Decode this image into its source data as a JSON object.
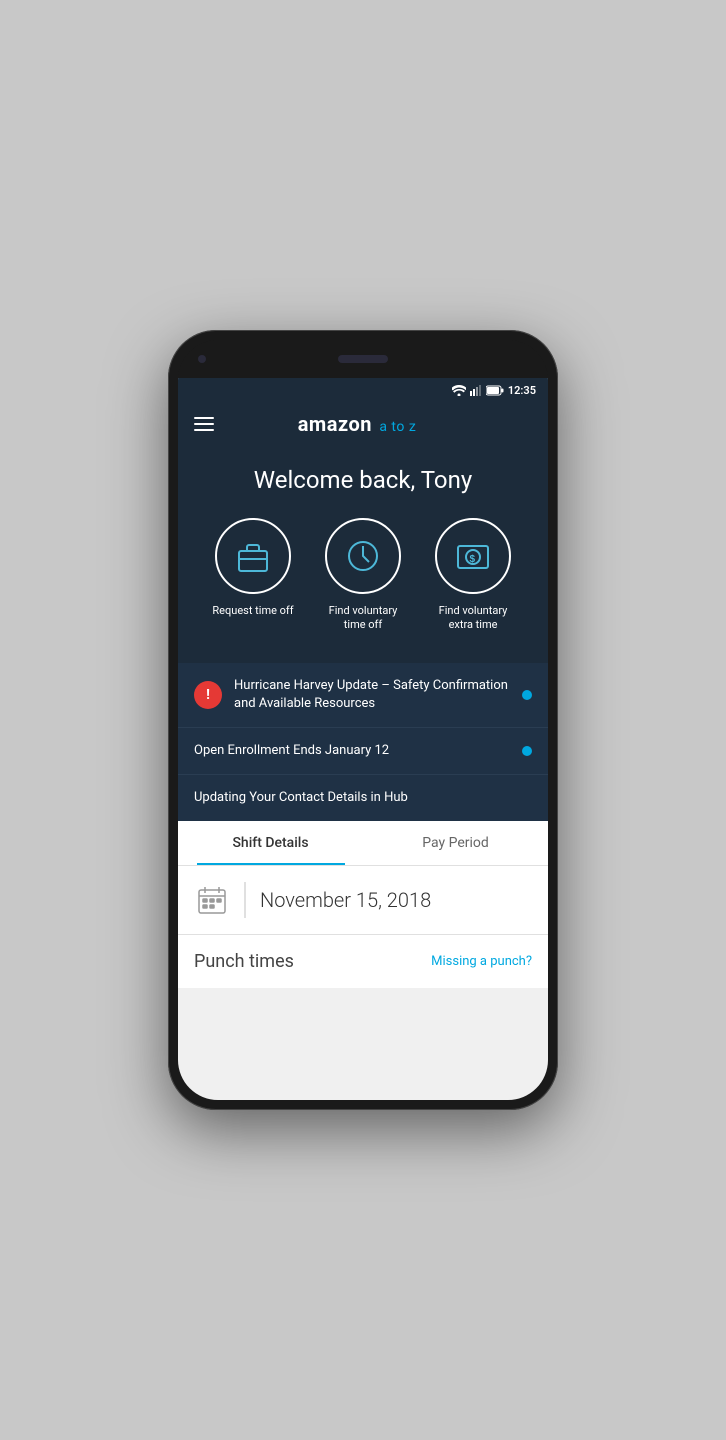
{
  "status_bar": {
    "time": "12:35"
  },
  "header": {
    "logo_amazon": "amazon",
    "logo_atoz": "a to z"
  },
  "hero": {
    "welcome": "Welcome back, Tony"
  },
  "actions": [
    {
      "id": "request-time-off",
      "icon": "💼",
      "label": "Request time off"
    },
    {
      "id": "find-vto",
      "icon": "🕐",
      "label": "Find voluntary time off"
    },
    {
      "id": "find-vet",
      "icon": "💵",
      "label": "Find voluntary extra time"
    }
  ],
  "notifications": [
    {
      "id": "hurricane-harvey",
      "hasAlert": true,
      "text": "Hurricane Harvey Update – Safety Confirmation and Available Resources",
      "hasDot": true
    },
    {
      "id": "open-enrollment",
      "hasAlert": false,
      "text": "Open Enrollment Ends January 12",
      "hasDot": true
    },
    {
      "id": "contact-details",
      "hasAlert": false,
      "text": "Updating Your Contact Details in Hub",
      "hasDot": false
    }
  ],
  "tabs": [
    {
      "id": "shift-details",
      "label": "Shift Details",
      "active": true
    },
    {
      "id": "pay-period",
      "label": "Pay Period",
      "active": false
    }
  ],
  "shift": {
    "date": "November 15, 2018"
  },
  "punch": {
    "label": "Punch times",
    "missing_link": "Missing a punch?"
  }
}
